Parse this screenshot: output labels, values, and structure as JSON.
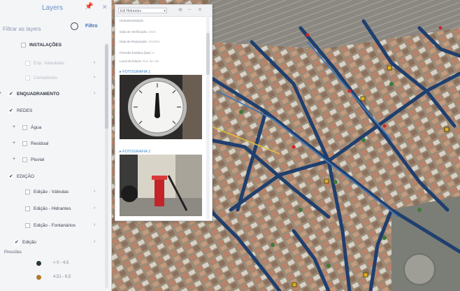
{
  "panel": {
    "title": "Layers",
    "filter_placeholder": "Filtrar as layers",
    "filter_button": "Filtro",
    "rows": [
      {
        "label": "INSTALAÇÕES",
        "toggle": "",
        "checked": false,
        "faded": false,
        "bold": true,
        "arrow": false
      },
      {
        "label": "Exp. Valvulidas",
        "toggle": "",
        "checked": false,
        "faded": true,
        "bold": false,
        "arrow": true
      },
      {
        "label": "Contadores",
        "toggle": "",
        "checked": false,
        "faded": true,
        "bold": false,
        "arrow": true
      },
      {
        "label": "ENQUADRAMENTO",
        "toggle": "+",
        "checked": true,
        "faded": false,
        "bold": true,
        "arrow": true
      },
      {
        "label": "REDES",
        "toggle": "-",
        "checked": true,
        "faded": false,
        "bold": false,
        "arrow": false
      },
      {
        "label": "Água",
        "toggle": "+",
        "checked": false,
        "faded": false,
        "bold": false,
        "arrow": false
      },
      {
        "label": "Residual",
        "toggle": "+",
        "checked": false,
        "faded": false,
        "bold": false,
        "arrow": false
      },
      {
        "label": "Pluvial",
        "toggle": "+",
        "checked": false,
        "faded": false,
        "bold": false,
        "arrow": false
      },
      {
        "label": "EDIÇÃO",
        "toggle": "-",
        "checked": true,
        "faded": false,
        "bold": false,
        "arrow": false
      },
      {
        "label": "Edição - Válvulas",
        "toggle": "",
        "checked": false,
        "faded": false,
        "bold": false,
        "arrow": true
      },
      {
        "label": "Edição - Hidrantes",
        "toggle": "",
        "checked": false,
        "faded": false,
        "bold": false,
        "arrow": true
      },
      {
        "label": "Edição - Fontanários",
        "toggle": "",
        "checked": false,
        "faded": false,
        "bold": false,
        "arrow": true
      },
      {
        "label": "Edição",
        "toggle": "",
        "checked": true,
        "faded": false,
        "bold": false,
        "arrow": true
      }
    ],
    "pressure_title": "Pressões",
    "legend": [
      {
        "label": "< 0 - 4,5",
        "color": "#2b3a2e"
      },
      {
        "label": "4,51 - 6,5",
        "color": "#b07a2a"
      }
    ]
  },
  "popup": {
    "select_value": "Edi Hidrantes",
    "lines": [
      {
        "k": "Hidrantes/Edição",
        "v": ""
      },
      {
        "k": "Data de Verificação:",
        "v": "2019"
      },
      {
        "k": "Data de Reparação:",
        "v": "2019/01"
      },
      {
        "k": "Pressão Estática (bar):",
        "v": "5"
      },
      {
        "k": "Local de leitura:",
        "v": "Rua da Vila"
      }
    ],
    "photo1_title": "▸ FOTOGRAFIA 1",
    "photo2_title": "▸ FOTOGRAFIA 2"
  }
}
